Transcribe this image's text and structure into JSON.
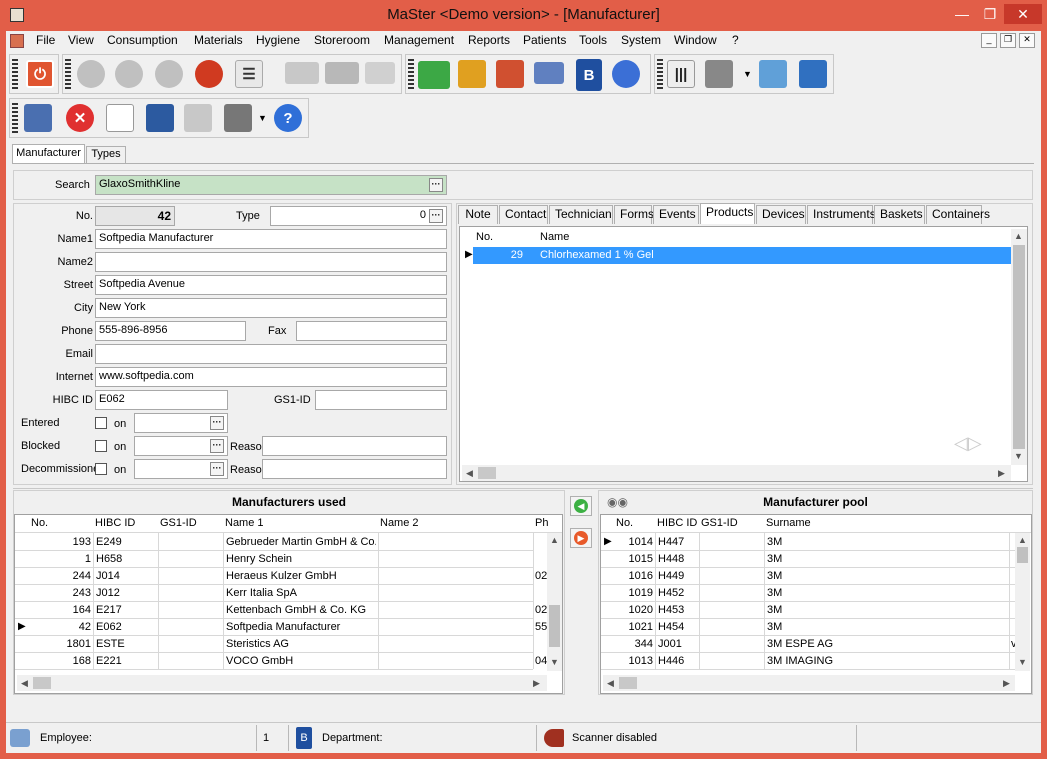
{
  "window": {
    "title": "MaSter <Demo version> - [Manufacturer]"
  },
  "menu": [
    "File",
    "View",
    "Consumption",
    "Materials",
    "Hygiene",
    "Storeroom",
    "Management",
    "Reports",
    "Patients",
    "Tools",
    "System",
    "Window",
    "?"
  ],
  "main_tabs": [
    "Manufacturer",
    "Types"
  ],
  "search": {
    "label": "Search",
    "value": "GlaxoSmithKline"
  },
  "form": {
    "no_label": "No.",
    "no_value": "42",
    "type_label": "Type",
    "type_value": "0",
    "name1_label": "Name1",
    "name1_value": "Softpedia Manufacturer",
    "name2_label": "Name2",
    "name2_value": "",
    "street_label": "Street",
    "street_value": "Softpedia Avenue",
    "city_label": "City",
    "city_value": "New York",
    "phone_label": "Phone",
    "phone_value": "555-896-8956",
    "fax_label": "Fax",
    "fax_value": "",
    "email_label": "Email",
    "email_value": "",
    "internet_label": "Internet",
    "internet_value": "www.softpedia.com",
    "hibc_label": "HIBC ID",
    "hibc_value": "E062",
    "gs1_label": "GS1-ID",
    "gs1_value": "",
    "entered_label": "Entered",
    "blocked_label": "Blocked",
    "decommissioned_label": "Decommissioned",
    "on_label": "on",
    "reason_label": "Reaso"
  },
  "detail_tabs": [
    "Note",
    "Contact",
    "Technician",
    "Forms",
    "Events",
    "Products",
    "Devices",
    "Instruments",
    "Baskets",
    "Containers"
  ],
  "products": {
    "headers": [
      "No.",
      "Name"
    ],
    "rows": [
      {
        "no": "29",
        "name": "Chlorhexamed 1 % Gel"
      }
    ]
  },
  "used": {
    "title": "Manufacturers used",
    "headers": [
      "No.",
      "HIBC ID",
      "GS1-ID",
      "Name 1",
      "Name 2",
      "Ph"
    ],
    "rows": [
      {
        "no": "193",
        "hibc": "E249",
        "gs1": "",
        "name1": "Gebrueder Martin GmbH & Co. K",
        "name2": "",
        "ph": ""
      },
      {
        "no": "1",
        "hibc": "H658",
        "gs1": "",
        "name1": "Henry Schein",
        "name2": "",
        "ph": ""
      },
      {
        "no": "244",
        "hibc": "J014",
        "gs1": "",
        "name1": "Heraeus Kulzer GmbH",
        "name2": "",
        "ph": "02"
      },
      {
        "no": "243",
        "hibc": "J012",
        "gs1": "",
        "name1": "Kerr Italia SpA",
        "name2": "",
        "ph": ""
      },
      {
        "no": "164",
        "hibc": "E217",
        "gs1": "",
        "name1": "Kettenbach GmbH & Co. KG",
        "name2": "",
        "ph": "02"
      },
      {
        "no": "42",
        "hibc": "E062",
        "gs1": "",
        "name1": "Softpedia Manufacturer",
        "name2": "",
        "ph": "55"
      },
      {
        "no": "1801",
        "hibc": "ESTE",
        "gs1": "",
        "name1": "Steristics AG",
        "name2": "",
        "ph": ""
      },
      {
        "no": "168",
        "hibc": "E221",
        "gs1": "",
        "name1": "VOCO GmbH",
        "name2": "",
        "ph": "04"
      }
    ]
  },
  "pool": {
    "title": "Manufacturer pool",
    "headers": [
      "No.",
      "HIBC ID",
      "GS1-ID",
      "Surname",
      ""
    ],
    "rows": [
      {
        "no": "1014",
        "hibc": "H447",
        "gs1": "",
        "surname": "3M",
        "x": ""
      },
      {
        "no": "1015",
        "hibc": "H448",
        "gs1": "",
        "surname": "3M",
        "x": ""
      },
      {
        "no": "1016",
        "hibc": "H449",
        "gs1": "",
        "surname": "3M",
        "x": ""
      },
      {
        "no": "1019",
        "hibc": "H452",
        "gs1": "",
        "surname": "3M",
        "x": ""
      },
      {
        "no": "1020",
        "hibc": "H453",
        "gs1": "",
        "surname": "3M",
        "x": ""
      },
      {
        "no": "1021",
        "hibc": "H454",
        "gs1": "",
        "surname": "3M",
        "x": ""
      },
      {
        "no": "344",
        "hibc": "J001",
        "gs1": "",
        "surname": "3M ESPE AG",
        "x": "v"
      },
      {
        "no": "1013",
        "hibc": "H446",
        "gs1": "",
        "surname": "3M IMAGING",
        "x": ""
      }
    ]
  },
  "status": {
    "employee_label": "Employee:",
    "count": "1",
    "department_label": "Department:",
    "scanner": "Scanner disabled"
  },
  "colors": {
    "accent": "#e25e48",
    "selection": "#3399ff",
    "search_bg": "#c6e2c6"
  }
}
